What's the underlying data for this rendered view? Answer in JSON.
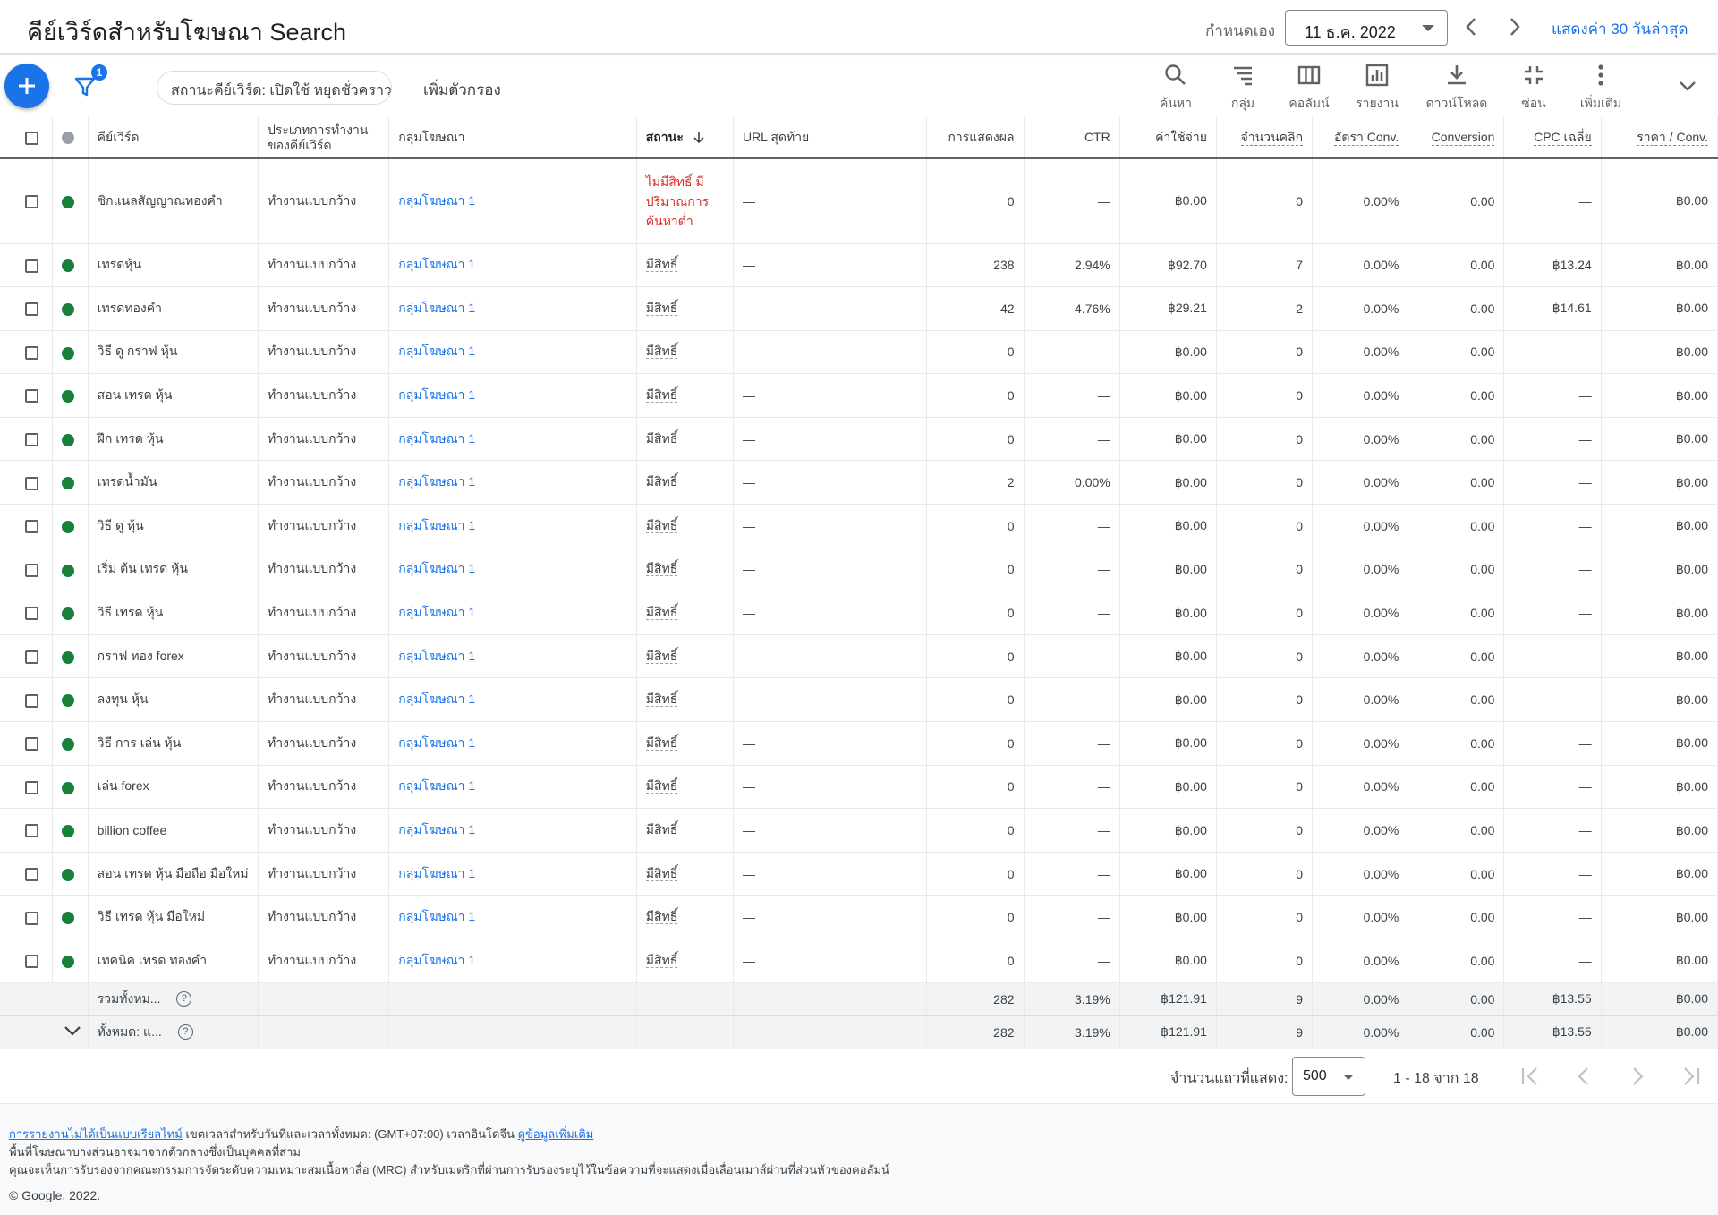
{
  "header": {
    "title": "คีย์เวิร์ดสำหรับโฆษณา Search",
    "date_mode": "กำหนดเอง",
    "date_value": "11 ธ.ค. 2022",
    "last30_label": "แสดงค่า 30 วันล่าสุด"
  },
  "toolbar": {
    "filter_badge": "1",
    "filter_chip": "สถานะคีย์เวิร์ด: เปิดใช้ หยุดชั่วคราว",
    "add_filter": "เพิ่มตัวกรอง",
    "tools": [
      {
        "label": "ค้นหา",
        "icon": "search-icon"
      },
      {
        "label": "กลุ่ม",
        "icon": "segment-icon"
      },
      {
        "label": "คอลัมน์",
        "icon": "columns-icon"
      },
      {
        "label": "รายงาน",
        "icon": "report-icon"
      },
      {
        "label": "ดาวน์โหลด",
        "icon": "download-icon"
      },
      {
        "label": "ซ่อน",
        "icon": "collapse-icon"
      },
      {
        "label": "เพิ่มเติม",
        "icon": "more-icon"
      }
    ]
  },
  "table": {
    "headers": {
      "keyword": "คีย์เวิร์ด",
      "match_type": "ประเภทการทำงานของคีย์เวิร์ด",
      "ad_group": "กลุ่มโฆษณา",
      "status": "สถานะ",
      "final_url": "URL สุดท้าย",
      "impressions": "การแสดงผล",
      "ctr": "CTR",
      "cost": "ค่าใช้จ่าย",
      "clicks": "จำนวนคลิก",
      "conv_rate": "อัตรา Conv.",
      "conversions": "Conversion",
      "avg_cpc": "CPC เฉลี่ย",
      "cost_per_conv": "ราคา / Conv."
    },
    "rows": [
      {
        "keyword": "ซิกแนลสัญญาณทองคำ",
        "match": "ทำงานแบบกว้าง",
        "group": "กลุ่มโฆษณา 1",
        "status": "ไม่มีสิทธิ์ มีปริมาณการค้นหาต่ำ",
        "url": "—",
        "impr": "0",
        "ctr": "—",
        "cost": "฿0.00",
        "clicks": "0",
        "conv_rate": "0.00%",
        "conv": "0.00",
        "cpc": "—",
        "cpa": "฿0.00",
        "tall": true
      },
      {
        "keyword": "เทรดหุ้น",
        "match": "ทำงานแบบกว้าง",
        "group": "กลุ่มโฆษณา 1",
        "status": "มีสิทธิ์",
        "url": "—",
        "impr": "238",
        "ctr": "2.94%",
        "cost": "฿92.70",
        "clicks": "7",
        "conv_rate": "0.00%",
        "conv": "0.00",
        "cpc": "฿13.24",
        "cpa": "฿0.00"
      },
      {
        "keyword": "เทรดทองคำ",
        "match": "ทำงานแบบกว้าง",
        "group": "กลุ่มโฆษณา 1",
        "status": "มีสิทธิ์",
        "url": "—",
        "impr": "42",
        "ctr": "4.76%",
        "cost": "฿29.21",
        "clicks": "2",
        "conv_rate": "0.00%",
        "conv": "0.00",
        "cpc": "฿14.61",
        "cpa": "฿0.00"
      },
      {
        "keyword": "วิธี ดู กราฟ หุ้น",
        "match": "ทำงานแบบกว้าง",
        "group": "กลุ่มโฆษณา 1",
        "status": "มีสิทธิ์",
        "url": "—",
        "impr": "0",
        "ctr": "—",
        "cost": "฿0.00",
        "clicks": "0",
        "conv_rate": "0.00%",
        "conv": "0.00",
        "cpc": "—",
        "cpa": "฿0.00"
      },
      {
        "keyword": "สอน เทรด หุ้น",
        "match": "ทำงานแบบกว้าง",
        "group": "กลุ่มโฆษณา 1",
        "status": "มีสิทธิ์",
        "url": "—",
        "impr": "0",
        "ctr": "—",
        "cost": "฿0.00",
        "clicks": "0",
        "conv_rate": "0.00%",
        "conv": "0.00",
        "cpc": "—",
        "cpa": "฿0.00"
      },
      {
        "keyword": "ฝึก เทรด หุ้น",
        "match": "ทำงานแบบกว้าง",
        "group": "กลุ่มโฆษณา 1",
        "status": "มีสิทธิ์",
        "url": "—",
        "impr": "0",
        "ctr": "—",
        "cost": "฿0.00",
        "clicks": "0",
        "conv_rate": "0.00%",
        "conv": "0.00",
        "cpc": "—",
        "cpa": "฿0.00"
      },
      {
        "keyword": "เทรดน้ำมัน",
        "match": "ทำงานแบบกว้าง",
        "group": "กลุ่มโฆษณา 1",
        "status": "มีสิทธิ์",
        "url": "—",
        "impr": "2",
        "ctr": "0.00%",
        "cost": "฿0.00",
        "clicks": "0",
        "conv_rate": "0.00%",
        "conv": "0.00",
        "cpc": "—",
        "cpa": "฿0.00"
      },
      {
        "keyword": "วิธี ดู หุ้น",
        "match": "ทำงานแบบกว้าง",
        "group": "กลุ่มโฆษณา 1",
        "status": "มีสิทธิ์",
        "url": "—",
        "impr": "0",
        "ctr": "—",
        "cost": "฿0.00",
        "clicks": "0",
        "conv_rate": "0.00%",
        "conv": "0.00",
        "cpc": "—",
        "cpa": "฿0.00"
      },
      {
        "keyword": "เริ่ม ต้น เทรด หุ้น",
        "match": "ทำงานแบบกว้าง",
        "group": "กลุ่มโฆษณา 1",
        "status": "มีสิทธิ์",
        "url": "—",
        "impr": "0",
        "ctr": "—",
        "cost": "฿0.00",
        "clicks": "0",
        "conv_rate": "0.00%",
        "conv": "0.00",
        "cpc": "—",
        "cpa": "฿0.00"
      },
      {
        "keyword": "วิธี เทรด หุ้น",
        "match": "ทำงานแบบกว้าง",
        "group": "กลุ่มโฆษณา 1",
        "status": "มีสิทธิ์",
        "url": "—",
        "impr": "0",
        "ctr": "—",
        "cost": "฿0.00",
        "clicks": "0",
        "conv_rate": "0.00%",
        "conv": "0.00",
        "cpc": "—",
        "cpa": "฿0.00"
      },
      {
        "keyword": "กราฟ ทอง forex",
        "match": "ทำงานแบบกว้าง",
        "group": "กลุ่มโฆษณา 1",
        "status": "มีสิทธิ์",
        "url": "—",
        "impr": "0",
        "ctr": "—",
        "cost": "฿0.00",
        "clicks": "0",
        "conv_rate": "0.00%",
        "conv": "0.00",
        "cpc": "—",
        "cpa": "฿0.00"
      },
      {
        "keyword": "ลงทุน หุ้น",
        "match": "ทำงานแบบกว้าง",
        "group": "กลุ่มโฆษณา 1",
        "status": "มีสิทธิ์",
        "url": "—",
        "impr": "0",
        "ctr": "—",
        "cost": "฿0.00",
        "clicks": "0",
        "conv_rate": "0.00%",
        "conv": "0.00",
        "cpc": "—",
        "cpa": "฿0.00"
      },
      {
        "keyword": "วิธี การ เล่น หุ้น",
        "match": "ทำงานแบบกว้าง",
        "group": "กลุ่มโฆษณา 1",
        "status": "มีสิทธิ์",
        "url": "—",
        "impr": "0",
        "ctr": "—",
        "cost": "฿0.00",
        "clicks": "0",
        "conv_rate": "0.00%",
        "conv": "0.00",
        "cpc": "—",
        "cpa": "฿0.00"
      },
      {
        "keyword": "เล่น forex",
        "match": "ทำงานแบบกว้าง",
        "group": "กลุ่มโฆษณา 1",
        "status": "มีสิทธิ์",
        "url": "—",
        "impr": "0",
        "ctr": "—",
        "cost": "฿0.00",
        "clicks": "0",
        "conv_rate": "0.00%",
        "conv": "0.00",
        "cpc": "—",
        "cpa": "฿0.00"
      },
      {
        "keyword": "billion coffee",
        "match": "ทำงานแบบกว้าง",
        "group": "กลุ่มโฆษณา 1",
        "status": "มีสิทธิ์",
        "url": "—",
        "impr": "0",
        "ctr": "—",
        "cost": "฿0.00",
        "clicks": "0",
        "conv_rate": "0.00%",
        "conv": "0.00",
        "cpc": "—",
        "cpa": "฿0.00"
      },
      {
        "keyword": "สอน เทรด หุ้น มือถือ มือใหม่",
        "match": "ทำงานแบบกว้าง",
        "group": "กลุ่มโฆษณา 1",
        "status": "มีสิทธิ์",
        "url": "—",
        "impr": "0",
        "ctr": "—",
        "cost": "฿0.00",
        "clicks": "0",
        "conv_rate": "0.00%",
        "conv": "0.00",
        "cpc": "—",
        "cpa": "฿0.00"
      },
      {
        "keyword": "วิธี เทรด หุ้น มือใหม่",
        "match": "ทำงานแบบกว้าง",
        "group": "กลุ่มโฆษณา 1",
        "status": "มีสิทธิ์",
        "url": "—",
        "impr": "0",
        "ctr": "—",
        "cost": "฿0.00",
        "clicks": "0",
        "conv_rate": "0.00%",
        "conv": "0.00",
        "cpc": "—",
        "cpa": "฿0.00"
      },
      {
        "keyword": "เทคนิค เทรด ทองคำ",
        "match": "ทำงานแบบกว้าง",
        "group": "กลุ่มโฆษณา 1",
        "status": "มีสิทธิ์",
        "url": "—",
        "impr": "0",
        "ctr": "—",
        "cost": "฿0.00",
        "clicks": "0",
        "conv_rate": "0.00%",
        "conv": "0.00",
        "cpc": "—",
        "cpa": "฿0.00"
      }
    ],
    "summary": [
      {
        "label": "รวมทั้งหม...",
        "impr": "282",
        "ctr": "3.19%",
        "cost": "฿121.91",
        "clicks": "9",
        "conv_rate": "0.00%",
        "conv": "0.00",
        "cpc": "฿13.55",
        "cpa": "฿0.00"
      },
      {
        "label": "ทั้งหมด: แ...",
        "impr": "282",
        "ctr": "3.19%",
        "cost": "฿121.91",
        "clicks": "9",
        "conv_rate": "0.00%",
        "conv": "0.00",
        "cpc": "฿13.55",
        "cpa": "฿0.00"
      }
    ]
  },
  "pagination": {
    "rows_label": "จำนวนแถวที่แสดง:",
    "rows_value": "500",
    "range": "1 - 18 จาก 18"
  },
  "footer": {
    "link1": "การรายงานไม่ได้เป็นแบบเรียลไทม์",
    "line1": " เขตเวลาสำหรับวันที่และเวลาทั้งหมด: (GMT+07:00) เวลาอินโดจีน ",
    "link2": "ดูข้อมูลเพิ่มเติม",
    "line2": "พื้นที่โฆษณาบางส่วนอาจมาจากตัวกลางซึ่งเป็นบุคคลที่สาม",
    "line3": "คุณจะเห็นการรับรองจากคณะกรรมการจัดระดับความเหมาะสมเนื้อหาสื่อ (MRC) สำหรับเมตริกที่ผ่านการรับรองระบุไว้ในข้อความที่จะแสดงเมื่อเลื่อนเมาส์ผ่านที่ส่วนหัวของคอลัมน์",
    "copyright": "© Google, 2022."
  }
}
